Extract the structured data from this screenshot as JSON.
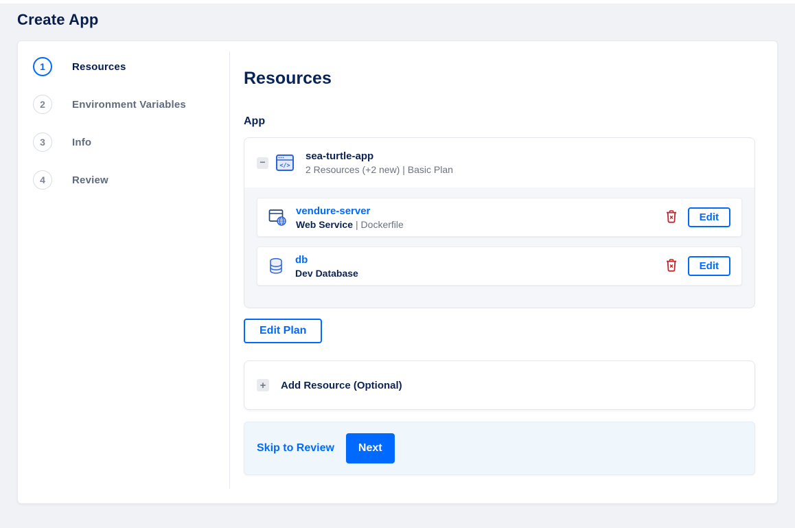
{
  "page": {
    "title": "Create App"
  },
  "theme": {
    "accent_blue": "#0069ff",
    "navy_text": "#031b4e",
    "gray_text": "#6b7280",
    "danger_red": "#c0252c",
    "page_background": "#f0f2f6",
    "app_card_body_background": "#f4f6f9",
    "footer_background": "#f0f7fc"
  },
  "stepper": {
    "steps": [
      {
        "number": "1",
        "label": "Resources",
        "active": true
      },
      {
        "number": "2",
        "label": "Environment Variables",
        "active": false
      },
      {
        "number": "3",
        "label": "Info",
        "active": false
      },
      {
        "number": "4",
        "label": "Review",
        "active": false
      }
    ]
  },
  "main": {
    "heading": "Resources",
    "section_label": "App",
    "app": {
      "name": "sea-turtle-app",
      "summary": "2 Resources (+2 new) | Basic Plan",
      "collapse_icon": "minus-icon",
      "app_icon": "code-window-icon",
      "resources": [
        {
          "name": "vendure-server",
          "meta_primary": "Web Service",
          "meta_secondary": "| Dockerfile",
          "icon": "web-service-icon",
          "delete_icon": "trash-icon",
          "edit_label": "Edit"
        },
        {
          "name": "db",
          "meta_primary": "Dev Database",
          "meta_secondary": "",
          "icon": "database-icon",
          "delete_icon": "trash-icon",
          "edit_label": "Edit"
        }
      ]
    },
    "edit_plan_label": "Edit Plan",
    "add_resource": {
      "icon": "plus-icon",
      "label": "Add Resource (Optional)"
    },
    "footer": {
      "skip_label": "Skip to Review",
      "next_label": "Next"
    }
  }
}
